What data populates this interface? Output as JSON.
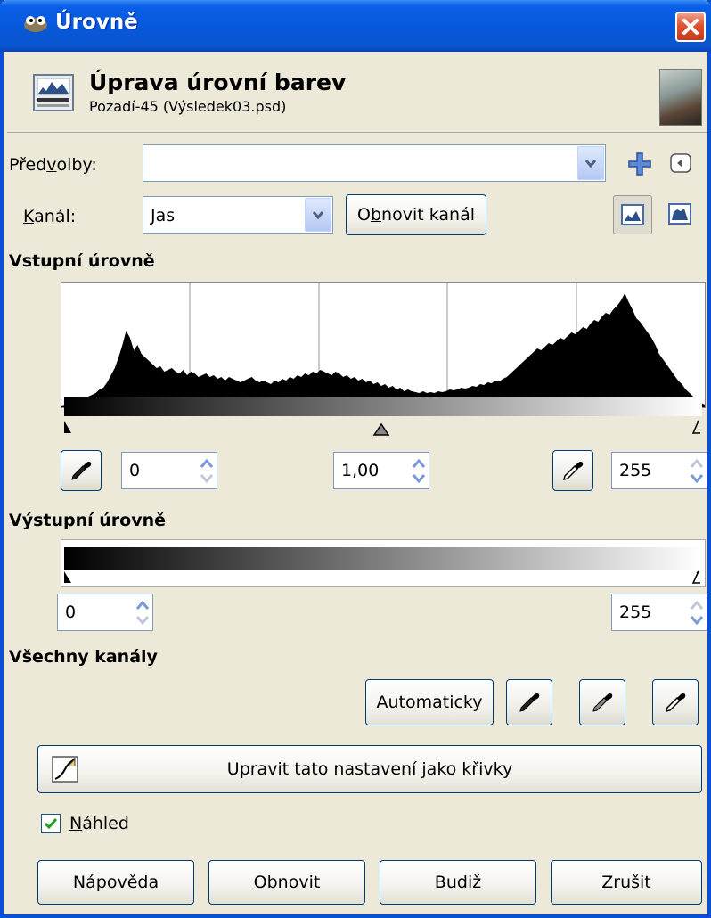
{
  "window": {
    "title": "Úrovně"
  },
  "header": {
    "title": "Úprava úrovní barev",
    "subtitle": "Pozadí-45 (Výsledek03.psd)"
  },
  "presets": {
    "label_pre": "Před",
    "label_ul": "v",
    "label_post": "olby:",
    "value": ""
  },
  "channel": {
    "label_ul": "K",
    "label_post": "anál:",
    "value": "Jas",
    "reset_pre": "O",
    "reset_ul": "b",
    "reset_post": "novit kanál"
  },
  "input_levels": {
    "heading": "Vstupní úrovně",
    "low": "0",
    "gamma": "1,00",
    "high": "255",
    "gamma_fraction": 0.5
  },
  "output_levels": {
    "heading": "Výstupní úrovně",
    "low": "0",
    "high": "255"
  },
  "all_channels": {
    "heading": "Všechny kanály",
    "auto_ul": "A",
    "auto_post": "utomaticky"
  },
  "curves_button": {
    "label": "Upravit tato nastavení jako křivky"
  },
  "preview": {
    "label_ul": "N",
    "label_post": "áhled",
    "checked": true
  },
  "footer": {
    "help_ul": "N",
    "help_post": "ápověda",
    "reset_ul": "O",
    "reset_post": "bnovit",
    "ok_ul": "B",
    "ok_post": "udiž",
    "cancel_ul": "Z",
    "cancel_post": "rušit"
  },
  "colors": {
    "title_bar": "#0a5fe8",
    "dialog_bg": "#ece9d8",
    "close": "#e0522f"
  },
  "histogram": [
    2,
    3,
    4,
    5,
    6,
    8,
    10,
    12,
    14,
    16,
    20,
    22,
    28,
    36,
    44,
    56,
    70,
    86,
    78,
    64,
    70,
    60,
    56,
    52,
    48,
    44,
    46,
    40,
    42,
    44,
    40,
    38,
    42,
    36,
    40,
    38,
    34,
    36,
    38,
    34,
    36,
    32,
    34,
    30,
    34,
    32,
    30,
    28,
    30,
    32,
    34,
    30,
    28,
    30,
    28,
    26,
    30,
    28,
    32,
    30,
    34,
    32,
    36,
    34,
    38,
    36,
    40,
    38,
    42,
    40,
    38,
    36,
    40,
    38,
    34,
    36,
    32,
    34,
    30,
    32,
    28,
    30,
    26,
    28,
    24,
    26,
    22,
    24,
    20,
    22,
    18,
    20,
    18,
    17,
    16,
    18,
    16,
    17,
    16,
    18,
    17,
    18,
    20,
    19,
    20,
    22,
    21,
    22,
    24,
    23,
    26,
    25,
    28,
    27,
    30,
    29,
    32,
    34,
    38,
    42,
    46,
    50,
    54,
    58,
    62,
    66,
    64,
    68,
    72,
    70,
    74,
    78,
    76,
    80,
    84,
    82,
    86,
    90,
    88,
    94,
    98,
    96,
    102,
    106,
    104,
    110,
    114,
    120,
    128,
    118,
    110,
    100,
    96,
    90,
    84,
    78,
    70,
    60,
    54,
    48,
    42,
    36,
    30,
    26,
    20,
    16,
    12,
    8,
    5,
    3
  ]
}
